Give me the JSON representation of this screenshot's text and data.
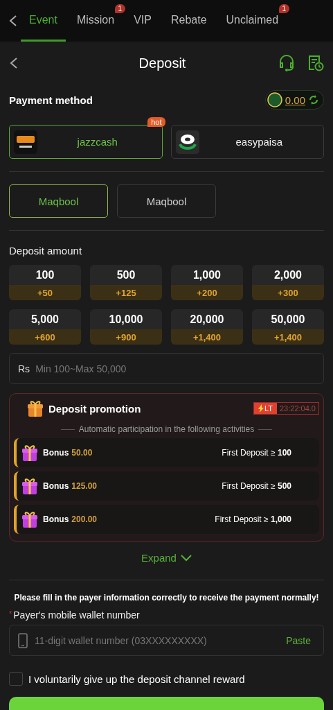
{
  "top_tabs": [
    {
      "label": "Event",
      "selected": true
    },
    {
      "label": "Mission",
      "selected": false,
      "badge": "1"
    },
    {
      "label": "VIP",
      "selected": false
    },
    {
      "label": "Rebate",
      "selected": false
    },
    {
      "label": "Unclaimed",
      "selected": false,
      "badge": "1"
    }
  ],
  "header": {
    "title": "Deposit"
  },
  "payment_method": {
    "title": "Payment method",
    "balance": "0.00"
  },
  "methods": [
    {
      "name": "jazzcash",
      "selected": true,
      "tag": "hot",
      "kind": "jazzcash"
    },
    {
      "name": "easypaisa",
      "selected": false,
      "kind": "easypaisa"
    }
  ],
  "channels": [
    {
      "label": "Maqbool",
      "selected": true
    },
    {
      "label": "Maqbool",
      "selected": false
    }
  ],
  "deposit_amount": {
    "title": "Deposit amount",
    "options": [
      {
        "amount": "100",
        "bonus": "+50"
      },
      {
        "amount": "500",
        "bonus": "+125"
      },
      {
        "amount": "1,000",
        "bonus": "+200"
      },
      {
        "amount": "2,000",
        "bonus": "+300"
      },
      {
        "amount": "5,000",
        "bonus": "+600"
      },
      {
        "amount": "10,000",
        "bonus": "+900"
      },
      {
        "amount": "20,000",
        "bonus": "+1,400"
      },
      {
        "amount": "50,000",
        "bonus": "+1,400"
      }
    ],
    "currency": "Rs",
    "placeholder": "Min 100~Max 50,000"
  },
  "promotion": {
    "title": "Deposit promotion",
    "timer_tag": "LT",
    "timer": "23:22:04.0",
    "subtitle": "Automatic participation in the following activities",
    "items": [
      {
        "label": "Bonus",
        "amount": "50.00",
        "condition": "First Deposit ≥ **100**"
      },
      {
        "label": "Bonus",
        "amount": "125.00",
        "condition": "First Deposit ≥ **500**"
      },
      {
        "label": "Bonus",
        "amount": "200.00",
        "condition": "First Deposit ≥ **1,000**"
      }
    ],
    "expand": "Expand"
  },
  "payer": {
    "notice": "Please fill in the payer information correctly to receive the payment normally!",
    "required_mark": "*",
    "label": "Payer's mobile wallet number",
    "placeholder": "11-digit wallet number (03XXXXXXXXX)",
    "paste": "Paste"
  },
  "reward_optout": {
    "label": "I voluntarily give up the deposit channel reward",
    "checked": false
  }
}
